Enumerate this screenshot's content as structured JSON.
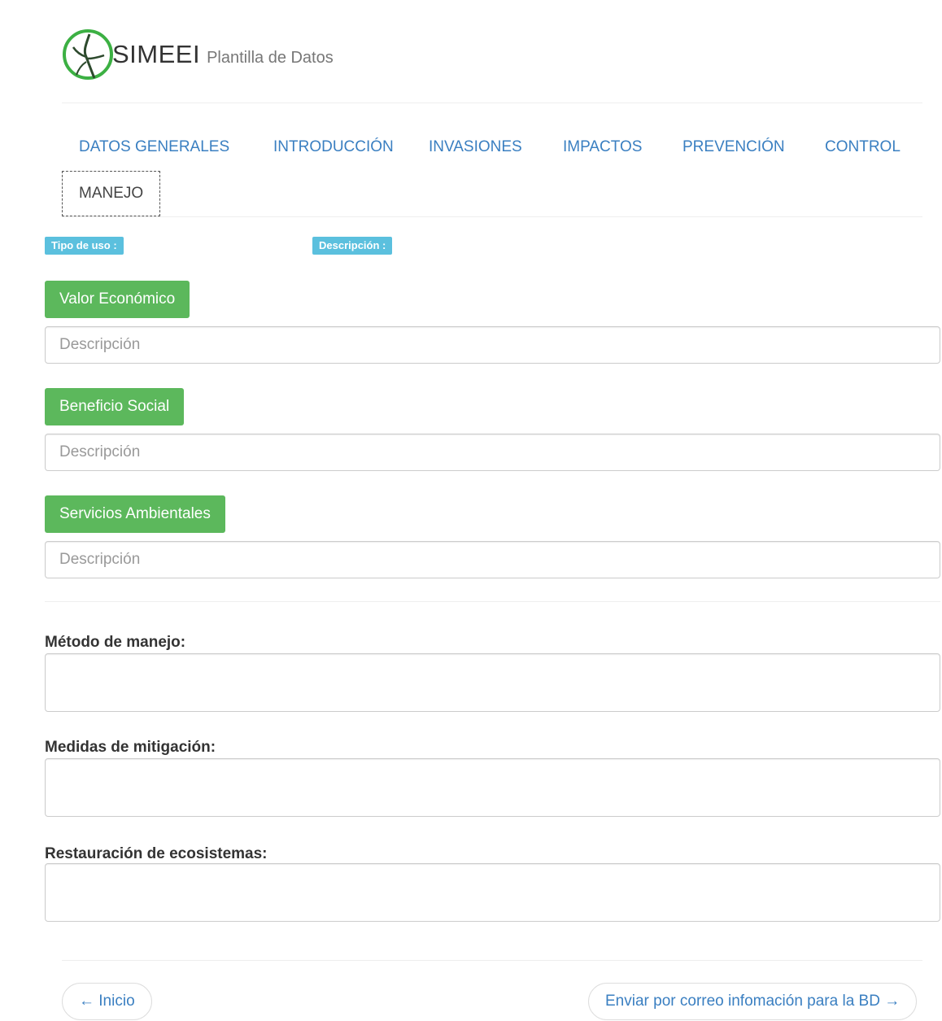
{
  "header": {
    "brand": "SIMEEI",
    "subtitle": "Plantilla de Datos"
  },
  "nav": {
    "tabs": [
      {
        "label": "DATOS GENERALES"
      },
      {
        "label": "INTRODUCCIÓN"
      },
      {
        "label": "INVASIONES"
      },
      {
        "label": "IMPACTOS"
      },
      {
        "label": "PREVENCIÓN"
      },
      {
        "label": "CONTROL"
      },
      {
        "label": "MANEJO",
        "active": true
      }
    ]
  },
  "labels": {
    "tipo_uso": "Tipo de uso :",
    "descripcion": "Descripción :"
  },
  "uses": [
    {
      "button": "Valor Económico",
      "placeholder": "Descripción"
    },
    {
      "button": "Beneficio Social",
      "placeholder": "Descripción"
    },
    {
      "button": "Servicios Ambientales",
      "placeholder": "Descripción"
    }
  ],
  "fields": {
    "metodo": "Método de manejo:",
    "mitigacion": "Medidas de mitigación:",
    "restauracion": "Restauración de ecosistemas:"
  },
  "pager": {
    "prev": "← Inicio",
    "next": "Enviar por correo infomación para la BD →"
  },
  "colors": {
    "green": "#5cb85c",
    "info": "#5bc0de",
    "link": "#3a7fc1"
  }
}
